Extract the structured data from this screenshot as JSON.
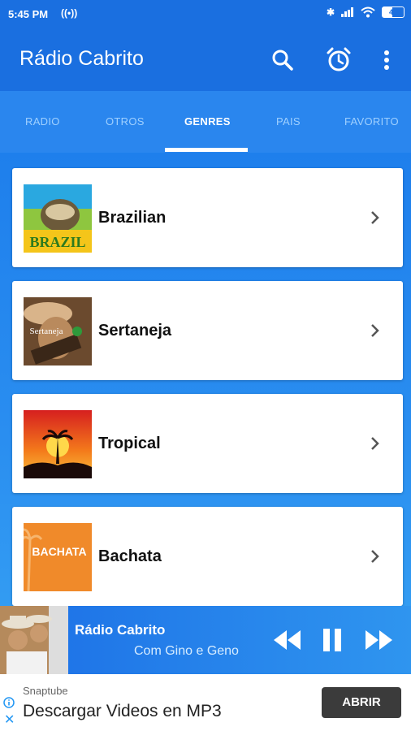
{
  "status_bar": {
    "time": "5:45 PM",
    "battery": "47"
  },
  "app_bar": {
    "title": "Rádio Cabrito"
  },
  "tabs": [
    {
      "label": "RADIO"
    },
    {
      "label": "OTROS"
    },
    {
      "label": "GENRES",
      "active": true
    },
    {
      "label": "PAIS"
    },
    {
      "label": "FAVORITO"
    }
  ],
  "genres": [
    {
      "label": "Brazilian",
      "thumb_text": "BRAZIL"
    },
    {
      "label": "Sertaneja",
      "thumb_text": "Sertaneja"
    },
    {
      "label": "Tropical"
    },
    {
      "label": "Bachata",
      "thumb_text": "BACHATA"
    }
  ],
  "player": {
    "title": "Rádio Cabrito",
    "subtitle": "Com Gino e Geno"
  },
  "ad": {
    "source": "Snaptube",
    "headline": "Descargar Videos en MP3",
    "button": "ABRIR"
  },
  "colors": {
    "primary": "#1a6fe0",
    "tab_bg": "#2a86ee",
    "accent_text": "#9fd0ff"
  }
}
